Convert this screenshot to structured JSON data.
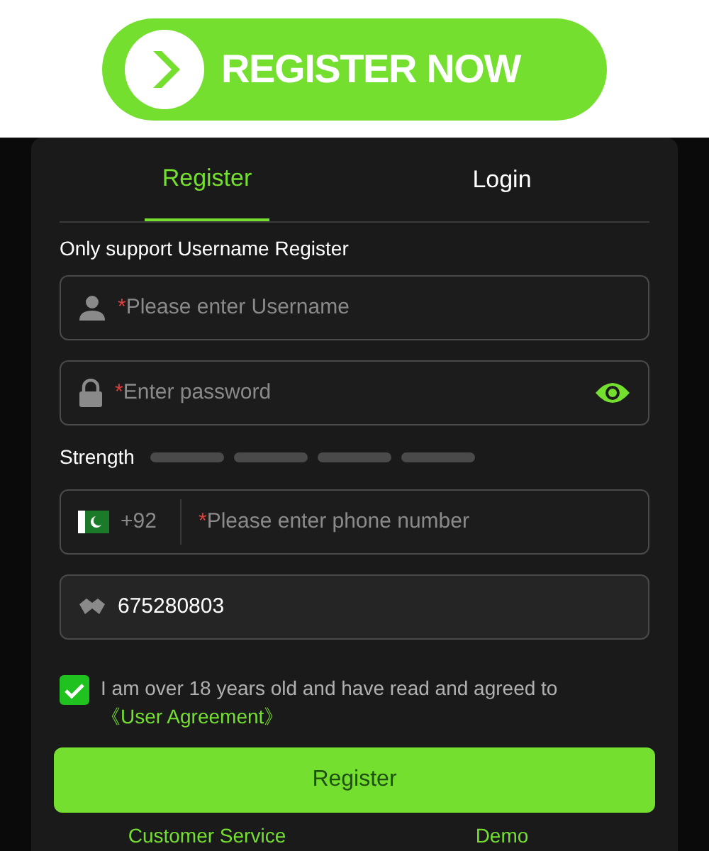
{
  "banner": {
    "label": "REGISTER NOW"
  },
  "tabs": [
    {
      "label": "Register",
      "selected": true
    },
    {
      "label": "Login",
      "selected": false
    }
  ],
  "note": "Only support Username Register",
  "username": {
    "required_mark": "*",
    "placeholder": "Please enter Username"
  },
  "password": {
    "required_mark": "*",
    "placeholder": "Enter password"
  },
  "strength": {
    "label": "Strength"
  },
  "phone": {
    "code": "+92",
    "required_mark": "*",
    "placeholder": "Please enter phone number"
  },
  "invite": {
    "value": "675280803"
  },
  "agreement": {
    "checked": true,
    "text": "I am over 18 years old and have read and agreed to",
    "link": "《User Agreement》"
  },
  "register_button": "Register",
  "footer_links": [
    "Customer Service",
    "Demo"
  ]
}
